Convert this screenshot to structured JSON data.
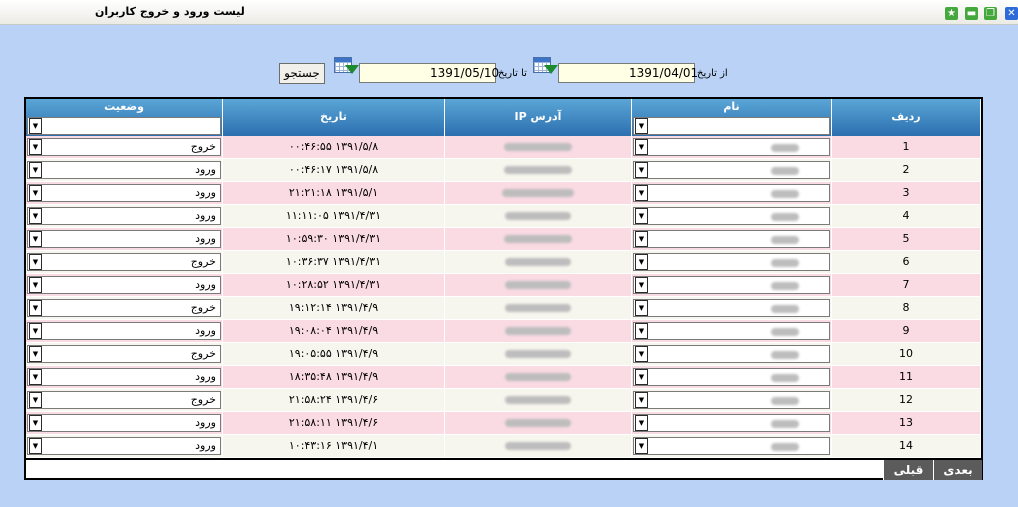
{
  "window": {
    "title": "لیست ورود و خروج کاربران"
  },
  "search": {
    "from_label": "از تاریخ",
    "from_value": "1391/04/01",
    "to_label": "تا تاریخ",
    "to_value": "1391/05/10",
    "button_label": "جستجو"
  },
  "table": {
    "headers": {
      "row": "ردیف",
      "name": "نام",
      "ip": "آدرس IP",
      "date": "تاریخ",
      "status": "وضعیت"
    },
    "rows": [
      {
        "num": "1",
        "date": "۱۳۹۱/۵/۸ ۰۰:۴۶:۵۵",
        "status": "خروج"
      },
      {
        "num": "2",
        "date": "۱۳۹۱/۵/۸ ۰۰:۴۶:۱۷",
        "status": "ورود"
      },
      {
        "num": "3",
        "date": "۱۳۹۱/۵/۱ ۲۱:۲۱:۱۸",
        "status": "ورود"
      },
      {
        "num": "4",
        "date": "۱۳۹۱/۴/۳۱ ۱۱:۱۱:۰۵",
        "status": "ورود"
      },
      {
        "num": "5",
        "date": "۱۳۹۱/۴/۳۱ ۱۰:۵۹:۳۰",
        "status": "ورود"
      },
      {
        "num": "6",
        "date": "۱۳۹۱/۴/۳۱ ۱۰:۳۶:۳۷",
        "status": "خروج"
      },
      {
        "num": "7",
        "date": "۱۳۹۱/۴/۳۱ ۱۰:۲۸:۵۲",
        "status": "ورود"
      },
      {
        "num": "8",
        "date": "۱۳۹۱/۴/۹ ۱۹:۱۲:۱۴",
        "status": "خروج"
      },
      {
        "num": "9",
        "date": "۱۳۹۱/۴/۹ ۱۹:۰۸:۰۴",
        "status": "ورود"
      },
      {
        "num": "10",
        "date": "۱۳۹۱/۴/۹ ۱۹:۰۵:۵۵",
        "status": "خروج"
      },
      {
        "num": "11",
        "date": "۱۳۹۱/۴/۹ ۱۸:۳۵:۴۸",
        "status": "ورود"
      },
      {
        "num": "12",
        "date": "۱۳۹۱/۴/۶ ۲۱:۵۸:۲۴",
        "status": "خروج"
      },
      {
        "num": "13",
        "date": "۱۳۹۱/۴/۶ ۲۱:۵۸:۱۱",
        "status": "ورود"
      },
      {
        "num": "14",
        "date": "۱۳۹۱/۴/۱ ۱۰:۴۳:۱۶",
        "status": "ورود"
      }
    ]
  },
  "pager": {
    "next_label": "بعدی",
    "prev_label": "قبلی"
  },
  "icons": {
    "calendar": "calendar-icon",
    "dropdown": "chevron-down-icon",
    "close": "close-icon",
    "maximize": "maximize-icon",
    "minimize": "minimize-icon",
    "favorite": "star-icon"
  },
  "colors": {
    "background": "#b9d2f5",
    "header": "#2c6fb0",
    "row_pink": "#fadbe4",
    "row_cream": "#f7f6ee",
    "date_field": "#ffffe6",
    "pager": "#5b5b5b"
  }
}
